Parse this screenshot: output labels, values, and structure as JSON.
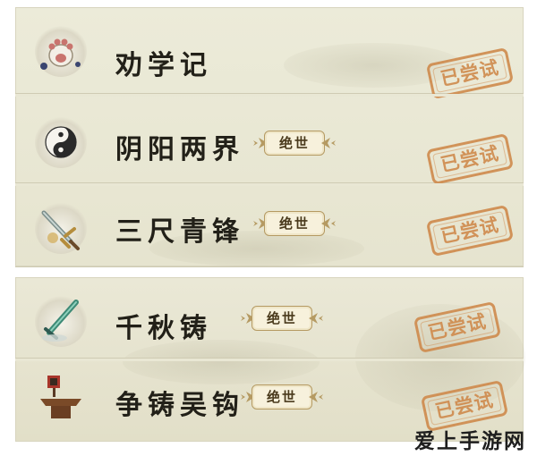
{
  "rows": [
    {
      "name": "劝学记",
      "icon": "paw-icon",
      "badge": "",
      "status": "已尝试"
    },
    {
      "name": "阴阳两界",
      "icon": "yin-yang-icon",
      "badge": "绝世",
      "status": "已尝试"
    },
    {
      "name": "三尺青锋",
      "icon": "sword-icon",
      "badge": "绝世",
      "status": "已尝试"
    },
    {
      "name": "千秋铸",
      "icon": "jade-sword-icon",
      "badge": "绝世",
      "status": "已尝试"
    },
    {
      "name": "争铸吴钩",
      "icon": "forge-anvil-icon",
      "badge": "绝世",
      "status": "已尝试"
    }
  ],
  "watermark": "爱上手游网",
  "colors": {
    "stamp": "#cf8a4c",
    "badge_border": "#b59a62",
    "panel": "#ecebd9",
    "text": "#222018"
  }
}
